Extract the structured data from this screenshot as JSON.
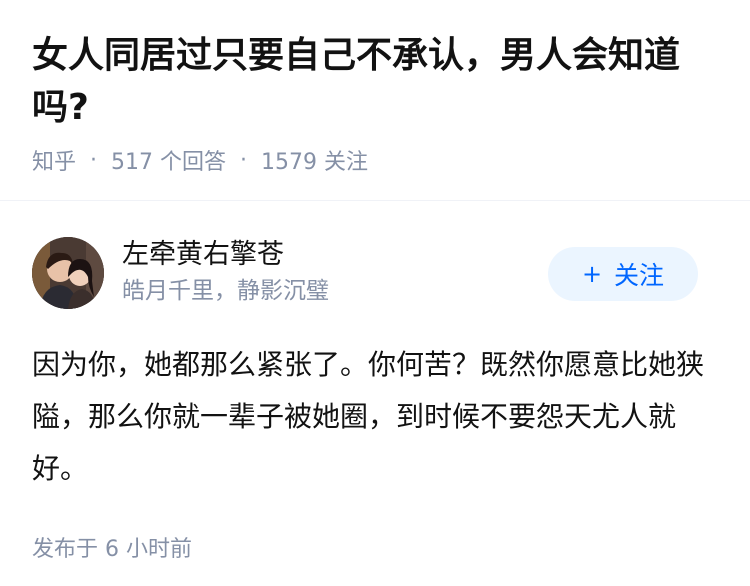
{
  "question": {
    "title": "女人同居过只要自己不承认，男人会知道吗?",
    "source": "知乎",
    "answer_count": "517 个回答",
    "follower_count": "1579 关注",
    "separator": "·"
  },
  "answer": {
    "author_name": "左牵黄右擎苍",
    "author_bio": "皓月千里，静影沉璧",
    "follow_plus": "+",
    "follow_label": "关注",
    "content": "因为你，她都那么紧张了。你何苦？既然你愿意比她狭隘，那么你就一辈子被她圈，到时候不要怨天尤人就好。",
    "published": "发布于  6 小时前"
  },
  "colors": {
    "meta": "#8590a6",
    "accent": "#0066ff",
    "follow_bg": "#ebf5ff"
  }
}
